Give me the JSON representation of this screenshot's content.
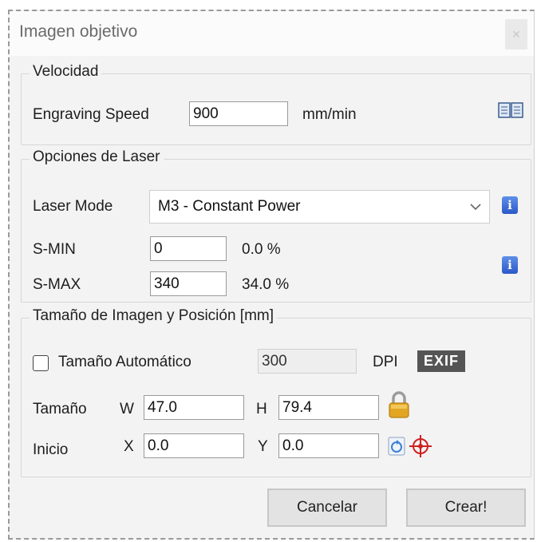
{
  "window": {
    "title": "Imagen objetivo",
    "close_glyph": "×"
  },
  "velocidad": {
    "legend": "Velocidad",
    "speed_label": "Engraving Speed",
    "speed_value": "900",
    "speed_unit": "mm/min",
    "help_icon": "book-icon"
  },
  "laser": {
    "legend": "Opciones de Laser",
    "mode_label": "Laser Mode",
    "mode_value": "M3 - Constant Power",
    "smin_label": "S-MIN",
    "smin_value": "0",
    "smin_pct": "0.0 %",
    "smax_label": "S-MAX",
    "smax_value": "340",
    "smax_pct": "34.0 %",
    "info_glyph": "i"
  },
  "tamano": {
    "legend": "Tamaño de Imagen y Posición [mm]",
    "auto_label": "Tamaño Automático",
    "auto_checked": false,
    "dpi_value": "300",
    "dpi_label": "DPI",
    "exif_label": "EXIF",
    "size_label": "Tamaño",
    "w_label": "W",
    "w_value": "47.0",
    "h_label": "H",
    "h_value": "79.4",
    "start_label": "Inicio",
    "x_label": "X",
    "x_value": "0.0",
    "y_label": "Y",
    "y_value": "0.0",
    "lock_icon": "lock-icon",
    "reset_icon": "reset-icon",
    "crosshair_icon": "crosshair-icon"
  },
  "buttons": {
    "cancel": "Cancelar",
    "create": "Crear!"
  },
  "colors": {
    "info_blue": "#2b58c9",
    "lock_gold": "#e2a524",
    "crosshair_red": "#d02020",
    "exif_gray": "#555555"
  }
}
